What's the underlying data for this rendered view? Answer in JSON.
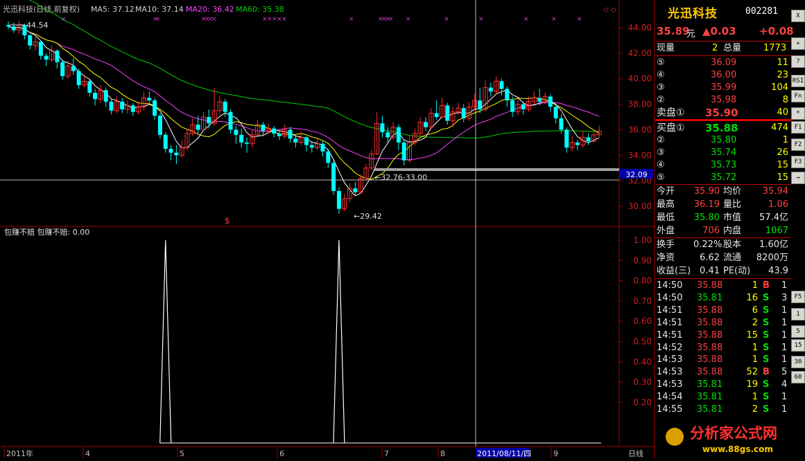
{
  "title": "光迅科技(日线,前复权)",
  "ma": {
    "ma5": "MA5: 37.12",
    "ma10": "MA10: 37.14",
    "ma20": "MA20: 36.42",
    "ma60": "MA60: 35.38"
  },
  "colors": {
    "up": "#ff3030",
    "down": "#00ffff",
    "ma5": "#ffffff",
    "ma10": "#ffff00",
    "ma20": "#ff40ff",
    "ma60": "#00d000",
    "grid": "#a00000",
    "pos": "#ff3030",
    "neg": "#00e000"
  },
  "price_axis": [
    "44.00",
    "42.00",
    "40.00",
    "38.00",
    "36.00",
    "34.00",
    "32.00",
    "30.00"
  ],
  "price_marker": "32.09",
  "annotations": {
    "high": "44.54",
    "low": "29.42",
    "range": "32.76-33.00",
    "dollar": "$"
  },
  "indicator": {
    "label": "包赚不赔 包赚不赔: 0.00"
  },
  "ind_axis": [
    "1.00",
    "0.90",
    "0.80",
    "0.70",
    "0.60",
    "0.50",
    "0.40",
    "0.30",
    "0.20"
  ],
  "date_axis": [
    "2011年",
    "4",
    "5",
    "6",
    "7",
    "8",
    "9"
  ],
  "cursor_date": "2011/08/11/四",
  "period": "日线",
  "chart_data": {
    "type": "candlestick",
    "title": "光迅科技(日线,前复权)",
    "ylim": [
      29,
      45
    ],
    "candles": [
      [
        44.2,
        44.1,
        44.5,
        43.9
      ],
      [
        44.1,
        43.8,
        44.4,
        43.6
      ],
      [
        43.8,
        44.2,
        44.54,
        43.5
      ],
      [
        44.2,
        43.4,
        44.3,
        43.1
      ],
      [
        43.4,
        42.6,
        43.5,
        42.3
      ],
      [
        42.6,
        42.9,
        43.3,
        42.2
      ],
      [
        42.9,
        41.8,
        43.0,
        41.5
      ],
      [
        41.8,
        41.5,
        42.0,
        41.0
      ],
      [
        41.5,
        42.2,
        42.6,
        41.3
      ],
      [
        42.2,
        41.3,
        42.3,
        40.8
      ],
      [
        41.3,
        40.2,
        41.5,
        39.9
      ],
      [
        40.2,
        41.0,
        41.4,
        40.0
      ],
      [
        41.0,
        40.6,
        41.6,
        40.3
      ],
      [
        40.6,
        39.5,
        40.8,
        39.2
      ],
      [
        39.5,
        39.8,
        40.3,
        39.3
      ],
      [
        39.8,
        38.9,
        40.0,
        38.6
      ],
      [
        38.9,
        38.4,
        39.2,
        37.9
      ],
      [
        38.4,
        39.1,
        39.5,
        38.1
      ],
      [
        39.1,
        38.2,
        39.3,
        37.8
      ],
      [
        38.2,
        37.5,
        38.4,
        37.2
      ],
      [
        37.5,
        38.2,
        38.6,
        37.3
      ],
      [
        38.2,
        37.6,
        38.5,
        37.3
      ],
      [
        37.6,
        37.9,
        38.3,
        37.3
      ],
      [
        37.9,
        37.4,
        38.1,
        37.1
      ],
      [
        37.4,
        37.8,
        38.2,
        37.2
      ],
      [
        37.8,
        38.5,
        39.0,
        37.5
      ],
      [
        38.5,
        38.3,
        39.0,
        38.1
      ],
      [
        38.3,
        37.1,
        38.5,
        36.8
      ],
      [
        37.1,
        35.6,
        37.3,
        35.3
      ],
      [
        35.6,
        34.5,
        35.8,
        34.2
      ],
      [
        34.5,
        34.2,
        34.8,
        33.6
      ],
      [
        34.2,
        34.0,
        34.8,
        33.3
      ],
      [
        34.0,
        34.6,
        35.2,
        33.8
      ],
      [
        34.6,
        35.7,
        36.1,
        34.4
      ],
      [
        35.7,
        36.4,
        36.9,
        35.5
      ],
      [
        36.4,
        36.0,
        37.1,
        35.7
      ],
      [
        36.0,
        37.0,
        37.4,
        35.9
      ],
      [
        37.0,
        36.5,
        37.6,
        36.1
      ],
      [
        36.5,
        37.5,
        39.3,
        36.3
      ],
      [
        37.5,
        38.2,
        38.6,
        37.2
      ],
      [
        38.2,
        37.4,
        38.4,
        37.0
      ],
      [
        37.4,
        36.0,
        37.6,
        35.7
      ],
      [
        36.0,
        35.6,
        36.3,
        34.9
      ],
      [
        35.6,
        35.0,
        36.1,
        34.6
      ],
      [
        35.0,
        34.9,
        35.4,
        34.2
      ],
      [
        34.9,
        35.6,
        36.0,
        34.6
      ],
      [
        35.6,
        36.4,
        36.8,
        35.4
      ],
      [
        36.4,
        35.9,
        36.6,
        35.5
      ],
      [
        35.9,
        36.1,
        36.5,
        35.7
      ],
      [
        36.1,
        35.7,
        36.3,
        35.4
      ],
      [
        35.7,
        35.5,
        36.0,
        35.2
      ],
      [
        35.5,
        36.0,
        36.4,
        35.3
      ],
      [
        36.0,
        35.3,
        36.2,
        35.0
      ],
      [
        35.3,
        35.0,
        35.6,
        34.6
      ],
      [
        35.0,
        35.4,
        35.9,
        34.8
      ],
      [
        35.4,
        34.8,
        35.5,
        34.3
      ],
      [
        34.8,
        34.6,
        35.1,
        34.2
      ],
      [
        34.6,
        34.9,
        35.3,
        34.4
      ],
      [
        34.9,
        34.3,
        35.1,
        33.9
      ],
      [
        34.3,
        33.4,
        34.5,
        33.0
      ],
      [
        33.4,
        31.2,
        33.6,
        30.9
      ],
      [
        31.2,
        29.8,
        31.5,
        29.42
      ],
      [
        29.8,
        30.6,
        31.0,
        29.6
      ],
      [
        30.6,
        31.4,
        31.8,
        30.3
      ],
      [
        31.4,
        31.1,
        31.9,
        30.8
      ],
      [
        31.1,
        32.2,
        32.5,
        31.0
      ],
      [
        32.2,
        33.0,
        33.3,
        32.0
      ],
      [
        33.0,
        34.1,
        34.4,
        32.8
      ],
      [
        34.1,
        36.5,
        37.4,
        34.0
      ],
      [
        36.5,
        35.8,
        37.1,
        35.4
      ],
      [
        35.8,
        35.4,
        36.2,
        35.0
      ],
      [
        35.4,
        36.2,
        36.6,
        35.2
      ],
      [
        36.2,
        35.0,
        36.4,
        34.4
      ],
      [
        35.0,
        33.6,
        35.2,
        33.2
      ],
      [
        33.6,
        35.0,
        35.5,
        33.4
      ],
      [
        35.0,
        35.7,
        36.1,
        34.8
      ],
      [
        35.7,
        36.6,
        37.0,
        35.5
      ],
      [
        36.6,
        36.2,
        37.0,
        35.9
      ],
      [
        36.2,
        37.3,
        37.7,
        36.0
      ],
      [
        37.3,
        37.0,
        38.3,
        36.8
      ],
      [
        37.0,
        37.9,
        38.5,
        36.9
      ],
      [
        37.9,
        36.7,
        38.1,
        36.4
      ],
      [
        36.7,
        37.4,
        37.8,
        36.2
      ],
      [
        37.4,
        37.7,
        38.1,
        37.2
      ],
      [
        37.7,
        36.9,
        38.0,
        36.6
      ],
      [
        36.9,
        37.8,
        38.2,
        36.7
      ],
      [
        37.8,
        38.3,
        38.8,
        37.5
      ],
      [
        38.3,
        37.6,
        39.3,
        37.3
      ],
      [
        37.6,
        39.3,
        39.9,
        37.4
      ],
      [
        39.3,
        39.0,
        39.7,
        38.6
      ],
      [
        39.0,
        39.8,
        40.2,
        38.8
      ],
      [
        39.8,
        39.2,
        40.0,
        38.7
      ],
      [
        39.2,
        38.3,
        39.4,
        37.8
      ],
      [
        38.3,
        37.4,
        38.6,
        37.0
      ],
      [
        37.4,
        38.0,
        38.4,
        37.1
      ],
      [
        38.0,
        37.6,
        38.2,
        37.2
      ],
      [
        37.6,
        38.2,
        38.6,
        37.4
      ],
      [
        38.2,
        38.5,
        39.0,
        38.0
      ],
      [
        38.5,
        38.2,
        39.2,
        37.9
      ],
      [
        38.2,
        38.6,
        38.9,
        38.0
      ],
      [
        38.6,
        37.8,
        38.8,
        37.4
      ],
      [
        37.8,
        36.9,
        38.0,
        36.5
      ],
      [
        36.9,
        36.0,
        37.2,
        35.7
      ],
      [
        36.0,
        34.6,
        36.2,
        34.2
      ],
      [
        34.6,
        35.0,
        35.5,
        34.3
      ],
      [
        35.0,
        34.8,
        35.2,
        34.4
      ],
      [
        34.8,
        35.4,
        35.9,
        34.6
      ],
      [
        35.4,
        35.1,
        35.7,
        34.8
      ],
      [
        35.1,
        35.6,
        36.0,
        35.0
      ],
      [
        35.6,
        35.9,
        36.3,
        35.4
      ]
    ],
    "indicator_values": [
      0,
      0,
      0,
      0,
      0,
      0,
      0,
      0,
      0,
      0,
      0,
      0,
      0,
      0,
      0,
      0,
      0,
      0,
      0,
      0,
      0,
      0,
      0,
      0,
      0,
      0,
      0,
      0,
      0,
      1,
      0,
      0,
      0,
      0,
      0,
      0,
      0,
      0,
      0,
      0,
      0,
      0,
      0,
      0,
      0,
      0,
      0,
      0,
      0,
      0,
      0,
      0,
      0,
      0,
      0,
      0,
      0,
      0,
      0,
      0,
      0,
      1,
      0,
      0,
      0,
      0,
      0,
      0,
      0,
      0,
      0,
      0,
      0,
      0,
      0,
      0,
      0,
      0,
      0,
      0,
      0,
      0,
      0,
      0,
      0,
      0,
      0,
      0,
      0,
      0,
      0,
      0,
      0,
      0,
      0,
      0,
      0,
      0,
      0,
      0,
      0,
      0,
      0,
      0,
      0,
      0,
      0,
      0,
      0,
      0
    ],
    "indicator_ylim": [
      0,
      1
    ],
    "indicator_xlabel_indices": [
      0,
      14,
      31,
      49,
      67,
      77,
      96
    ]
  },
  "quote": {
    "name": "光迅科技",
    "code": "002281",
    "price": "35.89",
    "unit": "元",
    "change": "▲0.03",
    "pct": "+0.08"
  },
  "vol_now": {
    "label1": "现量",
    "v1": "2",
    "label2": "总量",
    "v2": "1773"
  },
  "sell": [
    {
      "lv": "⑤",
      "p": "36.09",
      "v": "11"
    },
    {
      "lv": "④",
      "p": "36.00",
      "v": "23"
    },
    {
      "lv": "③",
      "p": "35.99",
      "v": "104"
    },
    {
      "lv": "②",
      "p": "35.98",
      "v": "8"
    },
    {
      "lv": "卖盘①",
      "p": "35.90",
      "v": "40"
    }
  ],
  "buy": [
    {
      "lv": "买盘①",
      "p": "35.88",
      "v": "474"
    },
    {
      "lv": "②",
      "p": "35.80",
      "v": "1"
    },
    {
      "lv": "③",
      "p": "35.74",
      "v": "26"
    },
    {
      "lv": "④",
      "p": "35.73",
      "v": "15"
    },
    {
      "lv": "⑤",
      "p": "35.72",
      "v": "15"
    }
  ],
  "stats": [
    {
      "l1": "今开",
      "v1": "35.90",
      "l2": "均价",
      "v2": "35.94"
    },
    {
      "l1": "最高",
      "v1": "36.19",
      "l2": "量比",
      "v2": "1.06"
    },
    {
      "l1": "最低",
      "v1": "35.80",
      "l2": "市值",
      "v2": "57.4亿"
    },
    {
      "l1": "外盘",
      "v1": "706",
      "l2": "内盘",
      "v2": "1067"
    }
  ],
  "stats2": [
    {
      "l1": "换手",
      "v1": "0.22%",
      "l2": "股本",
      "v2": "1.60亿"
    },
    {
      "l1": "净资",
      "v1": "6.62",
      "l2": "流通",
      "v2": "8200万"
    },
    {
      "l1": "收益(三)",
      "v1": "0.41",
      "l2": "PE(动)",
      "v2": "43.9"
    }
  ],
  "ticks": [
    {
      "t": "14:50",
      "p": "35.88",
      "v": "1",
      "bs": "B",
      "n": "1"
    },
    {
      "t": "14:50",
      "p": "35.81",
      "v": "16",
      "bs": "S",
      "n": "3"
    },
    {
      "t": "14:51",
      "p": "35.88",
      "v": "6",
      "bs": "S",
      "n": "1"
    },
    {
      "t": "14:51",
      "p": "35.88",
      "v": "2",
      "bs": "S",
      "n": "1"
    },
    {
      "t": "14:51",
      "p": "35.88",
      "v": "15",
      "bs": "S",
      "n": "1"
    },
    {
      "t": "14:52",
      "p": "35.88",
      "v": "1",
      "bs": "S",
      "n": "1"
    },
    {
      "t": "14:53",
      "p": "35.88",
      "v": "1",
      "bs": "S",
      "n": "1"
    },
    {
      "t": "14:53",
      "p": "35.88",
      "v": "52",
      "bs": "B",
      "n": "5"
    },
    {
      "t": "14:53",
      "p": "35.81",
      "v": "19",
      "bs": "S",
      "n": "4"
    },
    {
      "t": "14:54",
      "p": "35.81",
      "v": "1",
      "bs": "S",
      "n": "1"
    },
    {
      "t": "14:55",
      "p": "35.81",
      "v": "2",
      "bs": "S",
      "n": "1"
    }
  ],
  "sidebar_buttons": [
    "X",
    "RSI",
    "Fn",
    "F1",
    "F2",
    "F3",
    "F5",
    "1",
    "5",
    "15",
    "30",
    "60"
  ],
  "watermark": {
    "text": "分析家公式网",
    "url": "www.88gs.com"
  }
}
